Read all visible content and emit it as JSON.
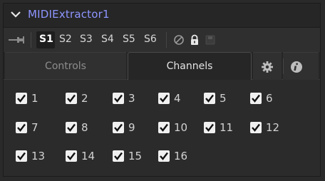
{
  "header": {
    "title": "MIDIExtractor1",
    "collapse_icon": "chevron-down-icon"
  },
  "toolbar": {
    "pin_icon": "pin-icon",
    "scenes": [
      "S1",
      "S2",
      "S3",
      "S4",
      "S5",
      "S6"
    ],
    "active_scene": "S1",
    "icons": [
      "disable-icon",
      "lock-icon",
      "save-icon"
    ]
  },
  "tabs": [
    {
      "label": "Controls",
      "active": false
    },
    {
      "label": "Channels",
      "active": true
    }
  ],
  "tab_icons": [
    "gear-icon",
    "info-icon"
  ],
  "channels": [
    {
      "label": "1",
      "checked": true
    },
    {
      "label": "2",
      "checked": true
    },
    {
      "label": "3",
      "checked": true
    },
    {
      "label": "4",
      "checked": true
    },
    {
      "label": "5",
      "checked": true
    },
    {
      "label": "6",
      "checked": true
    },
    {
      "label": "7",
      "checked": true
    },
    {
      "label": "8",
      "checked": true
    },
    {
      "label": "9",
      "checked": true
    },
    {
      "label": "10",
      "checked": true
    },
    {
      "label": "11",
      "checked": true
    },
    {
      "label": "12",
      "checked": true
    },
    {
      "label": "13",
      "checked": true
    },
    {
      "label": "14",
      "checked": true
    },
    {
      "label": "15",
      "checked": true
    },
    {
      "label": "16",
      "checked": true
    }
  ],
  "colors": {
    "title": "#8e95ff",
    "panel_bg": "#262626",
    "content_bg": "#2b2b2b"
  }
}
